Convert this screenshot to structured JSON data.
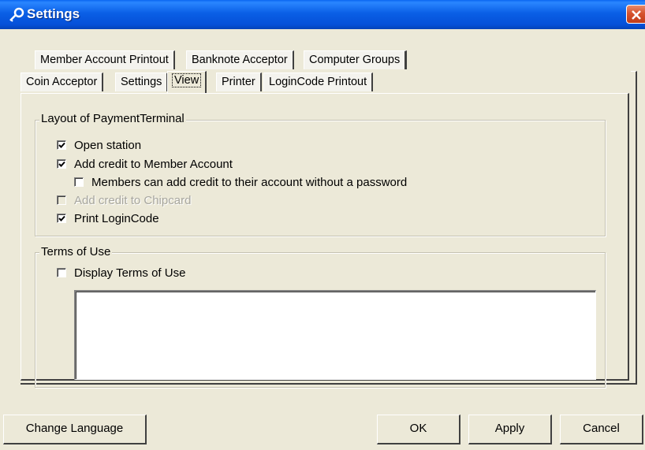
{
  "window": {
    "title": "Settings",
    "colors": {
      "titlebar": "#0054e3",
      "face": "#ece9d8",
      "close": "#d6532e"
    }
  },
  "tabs": {
    "back_row": [
      "Member Account Printout",
      "Banknote Acceptor",
      "Computer Groups"
    ],
    "front_row": [
      "Coin Acceptor",
      "Settings",
      "View",
      "Printer",
      "LoginCode Printout"
    ],
    "active": "View"
  },
  "layout_group": {
    "title": "Layout of PaymentTerminal",
    "options": [
      {
        "label": "Open station",
        "checked": true,
        "enabled": true
      },
      {
        "label": "Add credit to Member Account",
        "checked": true,
        "enabled": true
      },
      {
        "label": "Members can add credit to their account without a password",
        "checked": false,
        "enabled": true
      },
      {
        "label": "Add credit to Chipcard",
        "checked": false,
        "enabled": false
      },
      {
        "label": "Print LoginCode",
        "checked": true,
        "enabled": true
      }
    ]
  },
  "terms_group": {
    "title": "Terms of Use",
    "display_label": "Display Terms of Use",
    "display_checked": false,
    "text_value": ""
  },
  "buttons": {
    "change_language": "Change Language",
    "ok": "OK",
    "apply": "Apply",
    "cancel": "Cancel"
  },
  "icons": [
    "settings-key-icon",
    "close-icon",
    "checkmark-icon"
  ]
}
